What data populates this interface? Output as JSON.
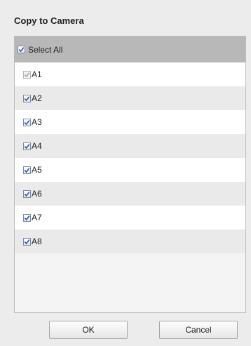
{
  "dialog": {
    "title": "Copy to Camera"
  },
  "select_all": {
    "label": "Select All",
    "checked": true
  },
  "cameras": [
    {
      "label": "A1",
      "checked": true,
      "disabled": true
    },
    {
      "label": "A2",
      "checked": true,
      "disabled": false
    },
    {
      "label": "A3",
      "checked": true,
      "disabled": false
    },
    {
      "label": "A4",
      "checked": true,
      "disabled": false
    },
    {
      "label": "A5",
      "checked": true,
      "disabled": false
    },
    {
      "label": "A6",
      "checked": true,
      "disabled": false
    },
    {
      "label": "A7",
      "checked": true,
      "disabled": false
    },
    {
      "label": "A8",
      "checked": true,
      "disabled": false
    }
  ],
  "buttons": {
    "ok_label": "OK",
    "cancel_label": "Cancel"
  },
  "colors": {
    "header_row": "#b8b8b8",
    "check_active": "#3a5a9a",
    "check_disabled": "#a8a8a8"
  },
  "icons": {
    "checkmark": "checkmark-icon"
  }
}
